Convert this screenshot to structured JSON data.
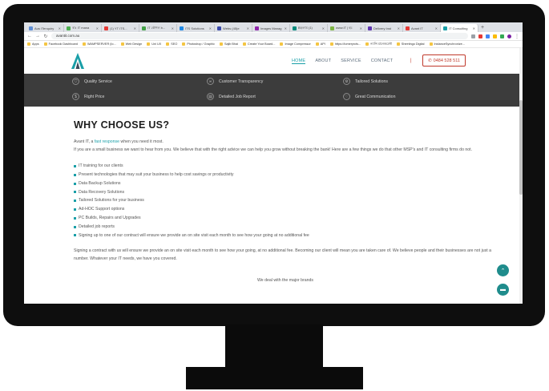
{
  "browser": {
    "tabs": [
      {
        "label": "Aus ITenquiry",
        "color": "#5f8fd6"
      },
      {
        "label": "ৰাঃ IT mana",
        "color": "#4caf50"
      },
      {
        "label": "(1) YT ITS...",
        "color": "#e53935"
      },
      {
        "label": "IT কৌশল b...",
        "color": "#43a047"
      },
      {
        "label": "ITS Solutions",
        "color": "#1e88e5"
      },
      {
        "label": "Webs (45)e",
        "color": "#3949ab"
      },
      {
        "label": "Images Manag",
        "color": "#8e24aa"
      },
      {
        "label": "Bড়লাম (1)",
        "color": "#00897b"
      },
      {
        "label": "www.IT | হচ",
        "color": "#7cb342"
      },
      {
        "label": "Delivery Inst",
        "color": "#5e35b1"
      },
      {
        "label": "Avant IT",
        "color": "#e53935"
      },
      {
        "label": "IT Consulting",
        "color": "#1a9fa8"
      }
    ],
    "url": "avantit.com.au",
    "bookmarks": [
      "Apps",
      "Facebook Dashboard",
      "WAMPSERVER (lo...",
      "Web Design",
      "Uni UX",
      "SEO",
      "Photoshop / Graphic",
      "Sajib Bhai",
      "Create Your Board...",
      "Image Compressor",
      "API",
      "https://tomeryrcts...",
      "ন্যান্সি মানেজমেন্ট",
      "Sheetingo Digital",
      "InstanceSynchronize..."
    ]
  },
  "site": {
    "nav": [
      "HOME",
      "ABOUT",
      "SERVICE",
      "CONTACT"
    ],
    "phone": "0484 528 511",
    "features": [
      {
        "icon": "shield-icon",
        "glyph": "⛉",
        "label": "Quality Service"
      },
      {
        "icon": "handshake-icon",
        "glyph": "∞",
        "label": "Customer Transparency"
      },
      {
        "icon": "gear-icon",
        "glyph": "⚙",
        "label": "Tailored Solutions"
      },
      {
        "icon": "price-tag-icon",
        "glyph": "$",
        "label": "Right Price"
      },
      {
        "icon": "document-icon",
        "glyph": "▤",
        "label": "Detailed Job Report"
      },
      {
        "icon": "heart-icon",
        "glyph": "♡",
        "label": "Great Communication"
      }
    ]
  },
  "content": {
    "heading": "WHY CHOOSE US?",
    "intro_pre": "Avant IT, a ",
    "intro_link": "fast response",
    "intro_post": " when you need it most.",
    "intro2": "If you are a small business we want to hear from you. We believe that with the right advice we can help you grow without breaking the bank! Here are a few things we do that other MSP's and IT consulting firms do not.",
    "list": [
      "IT training for our clients",
      "Present technologies that may suit your business to help cost savings or productivity",
      "Data Backup Solutions",
      "Data Recovery Solutions",
      "Tailored Solutions for your business",
      "Ad-HOC Support options",
      "PC Builds, Repairs and Upgrades",
      "Detailed job reports",
      "Signing up to one of our contract will ensure we provide an on site visit each month to see how your going at no additional fee"
    ],
    "para2": "Signing a contract with us will ensure we provide an on site visit each month to see how your going, at no additional fee. Becoming our client will mean you are taken care of. We believe people and their businesses are not just a number. Whatever your IT needs, we have you covered.",
    "brands": "We deal with the major brands"
  }
}
